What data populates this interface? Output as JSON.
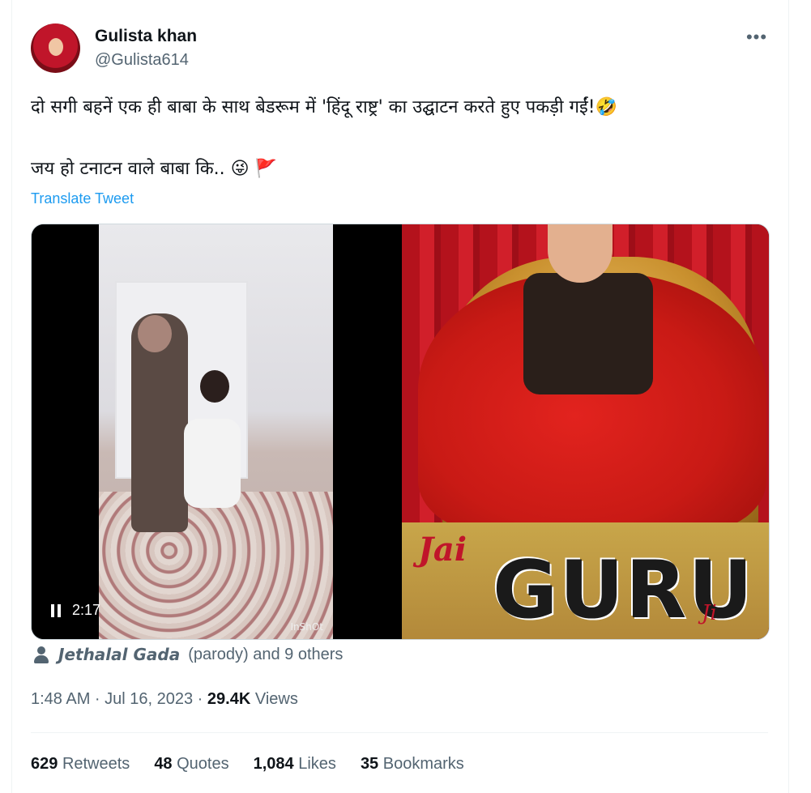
{
  "author": {
    "display_name": "Gulista khan",
    "handle": "@Gulista614"
  },
  "more_icon": "more-horizontal-icon",
  "tweet": {
    "line1": "दो सगी बहनें एक ही बाबा के साथ बेडरूम में 'हिंदू राष्ट्र' का उद्घाटन करते हुए पकड़ी गईं!🤣",
    "line2": "जय हो टनाटन वाले बाबा कि.. 😜 🚩",
    "translate": "Translate Tweet"
  },
  "media": {
    "video_time": "2:17",
    "video_watermark": "InShOt",
    "image_text_jai": "Jai",
    "image_text_guru": "GURU",
    "image_text_ji": "Ji"
  },
  "tagged": {
    "name": "Jethalal Gada",
    "rest": "(parody) and 9 others"
  },
  "meta": {
    "time": "1:48 AM · Jul 16, 2023 · ",
    "views_count": "29.4K",
    "views_label": " Views"
  },
  "stats": [
    {
      "count": "629",
      "label": "Retweets"
    },
    {
      "count": "48",
      "label": "Quotes"
    },
    {
      "count": "1,084",
      "label": "Likes"
    },
    {
      "count": "35",
      "label": "Bookmarks"
    }
  ]
}
